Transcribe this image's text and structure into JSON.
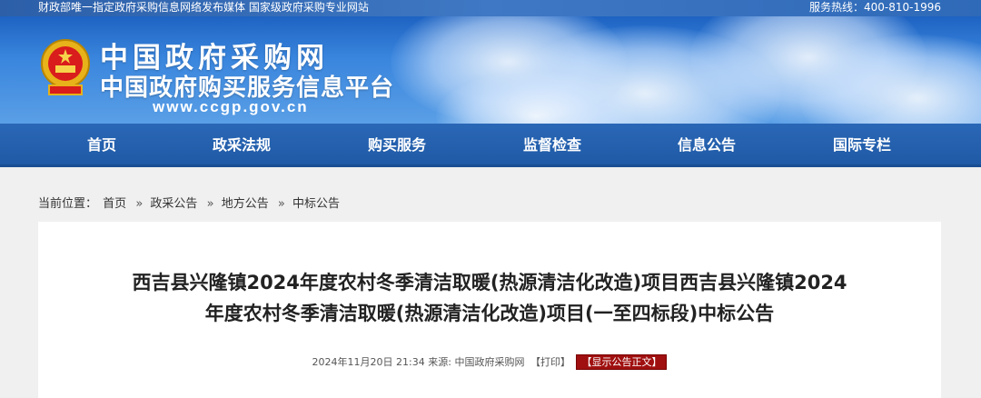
{
  "topbar": {
    "left_text": "财政部唯一指定政府采购信息网络发布媒体 国家级政府采购专业网站",
    "hotline": "服务热线：400-810-1996"
  },
  "header": {
    "title_cn": "中国政府采购网",
    "subtitle_cn": "中国政府购买服务信息平台",
    "url": "www.ccgp.gov.cn",
    "emblem": "national-emblem-icon"
  },
  "nav": {
    "items": [
      {
        "label": "首页"
      },
      {
        "label": "政采法规"
      },
      {
        "label": "购买服务"
      },
      {
        "label": "监督检查"
      },
      {
        "label": "信息公告"
      },
      {
        "label": "国际专栏"
      }
    ]
  },
  "breadcrumb": {
    "prefix": "当前位置：",
    "items": [
      "首页",
      "政采公告",
      "地方公告",
      "中标公告"
    ],
    "separator": "»"
  },
  "article": {
    "title_line1": "西吉县兴隆镇2024年度农村冬季清洁取暖(热源清洁化改造)项目西吉县兴隆镇2024",
    "title_line2": "年度农村冬季清洁取暖(热源清洁化改造)项目(一至四标段)中标公告",
    "datetime": "2024年11月20日 21:34",
    "source_label": "来源:",
    "source": "中国政府采购网",
    "print_label": "【打印】",
    "show_body_label": "【显示公告正文】"
  },
  "colors": {
    "nav_bg": "#1f5aa6",
    "show_btn_bg": "#a01010"
  }
}
